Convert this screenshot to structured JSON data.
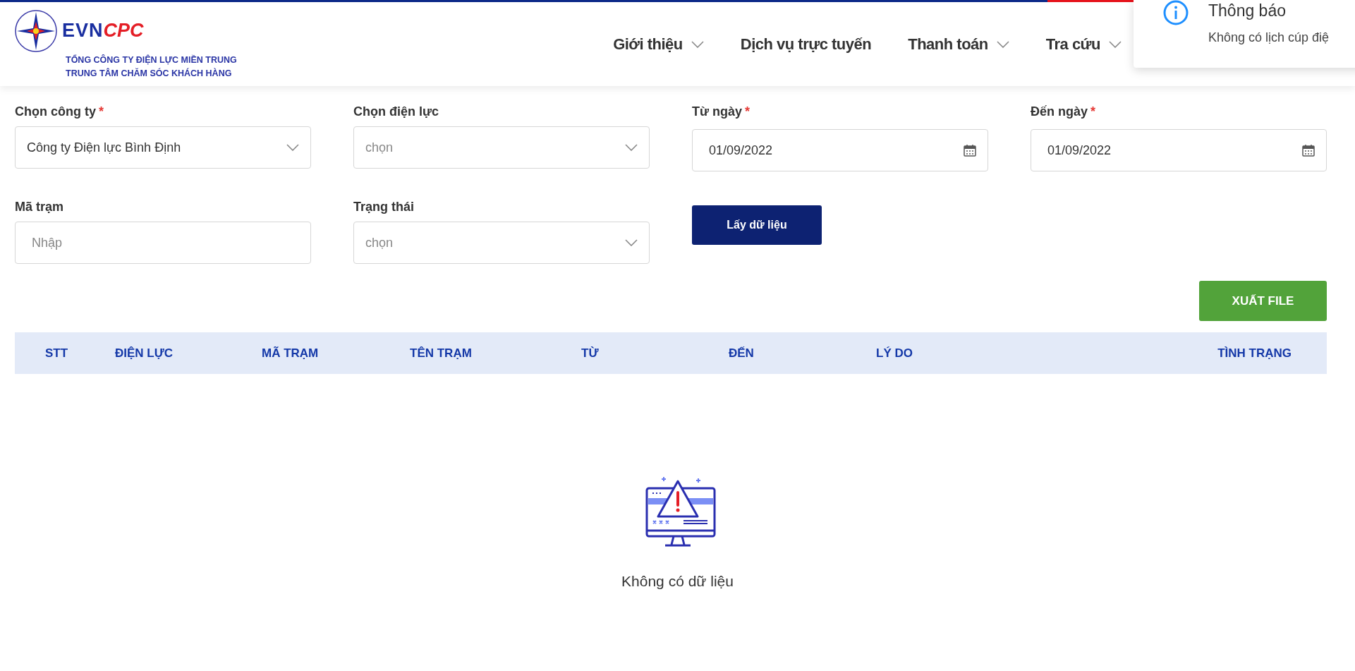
{
  "header": {
    "logo": {
      "brand_left": "EVN",
      "brand_right": "CPC",
      "lines": [
        "TỔNG CÔNG TY ĐIỆN LỰC MIỀN TRUNG",
        "TRUNG TÂM CHĂM SÓC KHÁCH HÀNG"
      ]
    },
    "nav": [
      {
        "label": "Giới thiệu",
        "dropdown": true
      },
      {
        "label": "Dịch vụ trực tuyến",
        "dropdown": false
      },
      {
        "label": "Thanh toán",
        "dropdown": true
      },
      {
        "label": "Tra cứu",
        "dropdown": true
      }
    ]
  },
  "toast": {
    "title": "Thông báo",
    "message": "Không có lịch cúp điệ"
  },
  "form": {
    "required_mark": "*",
    "rows": [
      [
        {
          "label": "Chọn công ty",
          "required": true,
          "kind": "select",
          "value": "Công ty Điện lực Bình Định"
        },
        {
          "label": "Chọn điện lực",
          "required": false,
          "kind": "select",
          "placeholder": "chọn"
        },
        {
          "label": "Từ ngày",
          "required": true,
          "kind": "date",
          "value": "01/09/2022"
        },
        {
          "label": "Đến ngày",
          "required": true,
          "kind": "date",
          "value": "01/09/2022"
        }
      ],
      [
        {
          "label": "Mã trạm",
          "required": false,
          "kind": "input",
          "placeholder": "Nhập"
        },
        {
          "label": "Trạng thái",
          "required": false,
          "kind": "select",
          "placeholder": "chọn"
        },
        {
          "label": "Lấy dữ liệu",
          "kind": "button"
        }
      ]
    ]
  },
  "export_button": "XUẤT FILE",
  "table": {
    "columns": [
      "STT",
      "ĐIỆN LỰC",
      "MÃ TRẠM",
      "TÊN TRẠM",
      "TỪ",
      "ĐẾN",
      "LÝ DO",
      "TÌNH TRẠNG"
    ],
    "empty_text": "Không có dữ liệu"
  }
}
